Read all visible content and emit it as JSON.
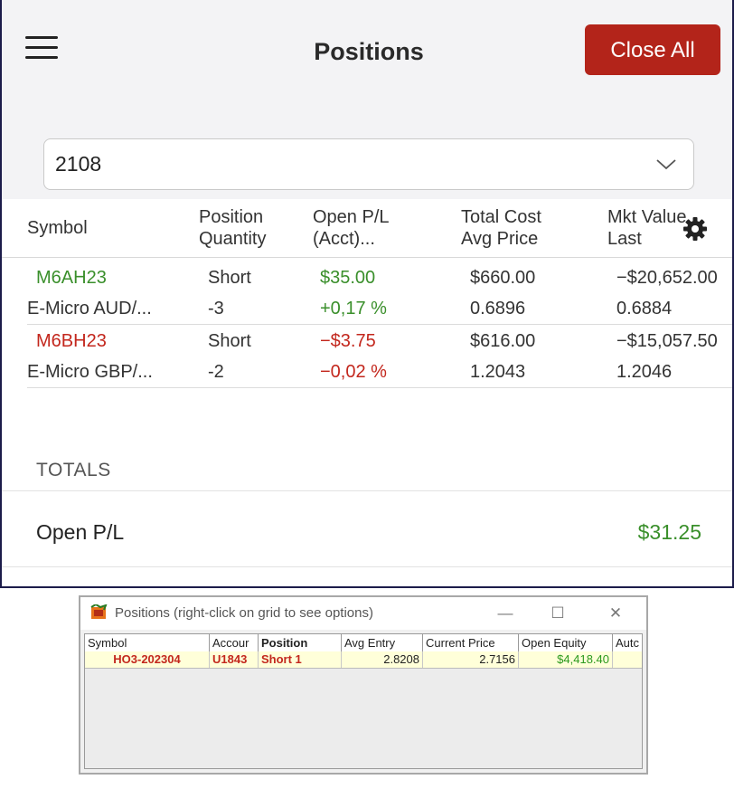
{
  "app": {
    "title": "Positions",
    "close_all": "Close All",
    "account": "2108",
    "columns": [
      {
        "line1": "Symbol",
        "line2": ""
      },
      {
        "line1": "Position",
        "line2": "Quantity"
      },
      {
        "line1": "Open P/L",
        "line2": "(Acct)..."
      },
      {
        "line1": "Total Cost",
        "line2": "Avg Price"
      },
      {
        "line1": "Mkt Value",
        "line2": "Last"
      }
    ],
    "rows": [
      {
        "symbol": "M6AH23",
        "desc": "E-Micro AUD/...",
        "side": "Short",
        "qty": "-3",
        "pl": "$35.00",
        "pl_pct": "+0,17 %",
        "total_cost": "$660.00",
        "avg_price": "0.6896",
        "mkt_value": "−$20,652.00",
        "last": "0.6884",
        "status_color": "#3a8f2b"
      },
      {
        "symbol": "M6BH23",
        "desc": "E-Micro GBP/...",
        "side": "Short",
        "qty": "-2",
        "pl": "−$3.75",
        "pl_pct": "−0,02 %",
        "total_cost": "$616.00",
        "avg_price": "1.2043",
        "mkt_value": "−$15,057.50",
        "last": "1.2046",
        "status_color": "#c3271d"
      }
    ],
    "totals_label": "TOTALS",
    "open_pl_label": "Open P/L",
    "open_pl_value": "$31.25"
  },
  "window": {
    "title": "Positions (right-click on grid to see options)",
    "columns": [
      "Symbol",
      "Accour",
      "Position",
      "Avg Entry",
      "Current Price",
      "Open Equity",
      "Autc"
    ],
    "row": {
      "symbol": "HO3-202304",
      "account": "U1843",
      "position": "Short 1",
      "avg_entry": "2.8208",
      "current_price": "2.7156",
      "open_equity": "$4,418.40"
    }
  },
  "icons": [
    "menu-icon",
    "chevron-down-icon",
    "gear-icon",
    "app-icon",
    "minimize-icon",
    "maximize-icon",
    "close-icon"
  ],
  "colors": {
    "accent": "#b3241a",
    "profit": "#3a8f2b",
    "loss": "#c3271d",
    "highlight_row": "#ffffd9"
  }
}
